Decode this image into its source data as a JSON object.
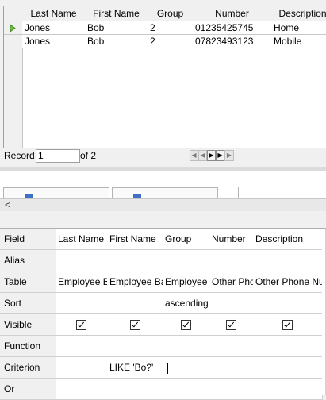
{
  "grid": {
    "columns": [
      "Last Name",
      "First Name",
      "Group",
      "Number",
      "Description"
    ],
    "rows": [
      [
        "Jones",
        "Bob",
        "2",
        "01235425745",
        "Home"
      ],
      [
        "Jones",
        "Bob",
        "2",
        "07823493123",
        "Mobile"
      ]
    ]
  },
  "record_bar": {
    "label": "Record",
    "current": "1",
    "of_text": "of 2"
  },
  "design": {
    "row_labels": [
      "Field",
      "Alias",
      "Table",
      "Sort",
      "Visible",
      "Function",
      "Criterion",
      "Or"
    ],
    "columns": [
      {
        "field": "Last Name",
        "alias": "",
        "table": "Employee B",
        "sort": "",
        "visible": true,
        "function": "",
        "criterion": "",
        "or": ""
      },
      {
        "field": "First Name",
        "alias": "",
        "table": "Employee Ba",
        "sort": "",
        "visible": true,
        "function": "",
        "criterion": "LIKE 'Bo?'",
        "or": ""
      },
      {
        "field": "Group",
        "alias": "",
        "table": "Employee",
        "sort": "ascending",
        "visible": true,
        "function": "",
        "criterion": "",
        "or": ""
      },
      {
        "field": "Number",
        "alias": "",
        "table": "Other Pho",
        "sort": "",
        "visible": true,
        "function": "",
        "criterion": "",
        "or": ""
      },
      {
        "field": "Description",
        "alias": "",
        "table": "Other Phone Nu",
        "sort": "",
        "visible": true,
        "function": "",
        "criterion": "",
        "or": ""
      }
    ]
  }
}
